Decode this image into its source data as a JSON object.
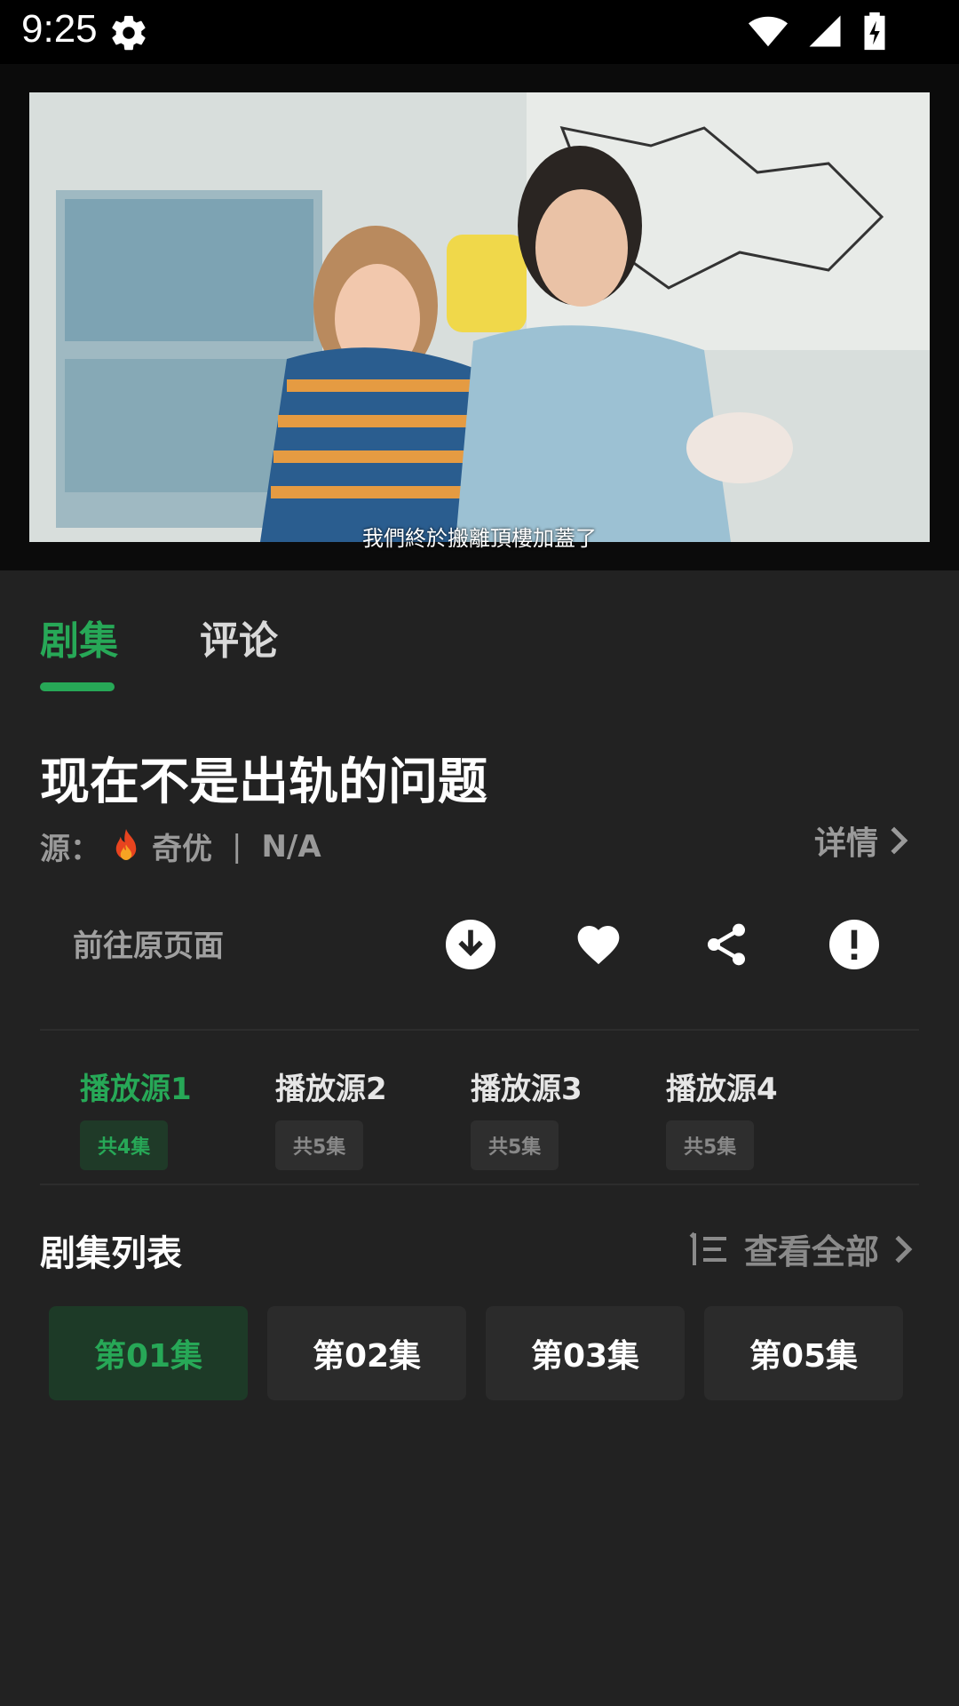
{
  "status_bar": {
    "time": "9:25"
  },
  "video": {
    "subtitle": "我們終於搬離頂樓加蓋了"
  },
  "tabs": [
    {
      "label": "剧集"
    },
    {
      "label": "评论"
    }
  ],
  "show": {
    "title": "现在不是出轨的问题",
    "source_label": "源：",
    "source_name": "奇优",
    "separator": "|",
    "extra": "N/A",
    "details_label": "详情"
  },
  "actions": {
    "goto_label": "前往原页面"
  },
  "sources": [
    {
      "name": "播放源1",
      "count": "共4集"
    },
    {
      "name": "播放源2",
      "count": "共5集"
    },
    {
      "name": "播放源3",
      "count": "共5集"
    },
    {
      "name": "播放源4",
      "count": "共5集"
    }
  ],
  "episode_list": {
    "title": "剧集列表",
    "view_all": "查看全部",
    "episodes": [
      "第01集",
      "第02集",
      "第03集",
      "第05集"
    ]
  },
  "colors": {
    "accent": "#27a857",
    "background": "#222222"
  }
}
